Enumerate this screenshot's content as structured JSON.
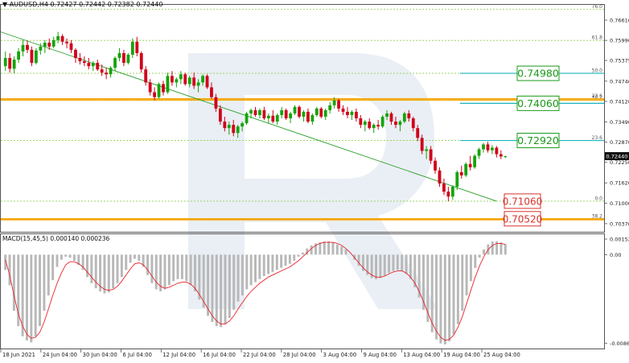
{
  "header": {
    "symbol": "▼ AUDUSD,H4",
    "ohlc": "0.72427 0.72442 0.72382 0.72440"
  },
  "macd_header": "MACD(15,45,5) 0.000140 0.000236",
  "colors": {
    "bull": "#16a30b",
    "bear": "#d0021b",
    "fib_grid": "#8fd14f",
    "fib_orange": "#f5a300",
    "teal_line": "#19b5bd",
    "trendline": "#2ba02b",
    "macd_hist": "#b8b8b8",
    "macd_signal": "#e8232a"
  },
  "chart_data": [
    {
      "type": "candlestick",
      "title": "",
      "x_ticks": [
        "18 Jun 2021",
        "24 Jun 04:00",
        "30 Jun 04:00",
        "6 Jul 04:00",
        "12 Jul 04:00",
        "16 Jul 04:00",
        "22 Jul 04:00",
        "28 Jul 04:00",
        "3 Aug 04:00",
        "9 Aug 04:00",
        "13 Aug 04:00",
        "19 Aug 04:00",
        "25 Aug 04:00"
      ],
      "y_ticks": [
        "0.76610",
        "0.75990",
        "0.75375",
        "0.74740",
        "0.74120",
        "0.73490",
        "0.72870",
        "0.72250",
        "0.71620",
        "0.71000",
        "0.70370"
      ],
      "ylim": [
        0.7012,
        0.7708
      ],
      "current_price": "0.72440",
      "fib_levels": [
        {
          "label": "76.0",
          "value": 0.7694
        },
        {
          "label": "61.8",
          "value": 0.7599
        },
        {
          "label": "50.0",
          "value": 0.7498
        },
        {
          "label": "38.2",
          "value": 0.7415
        },
        {
          "label": "23.6",
          "value": 0.742
        },
        {
          "label": "23.6",
          "value": 0.7292
        },
        {
          "label": "0.0",
          "value": 0.7106
        },
        {
          "label": "38.2",
          "value": 0.7052
        }
      ],
      "orange_lines": [
        0.742,
        0.7416,
        0.7052,
        0.7049
      ],
      "target_boxes": [
        {
          "label": "0.74980",
          "value": 0.7498,
          "style": "green"
        },
        {
          "label": "0.74060",
          "value": 0.7406,
          "style": "green"
        },
        {
          "label": "0.72920",
          "value": 0.7292,
          "style": "green"
        },
        {
          "label": "0.71060",
          "value": 0.7106,
          "style": "red"
        },
        {
          "label": "0.70520",
          "value": 0.7052,
          "style": "red"
        }
      ],
      "trendline": {
        "from": [
          0,
          0.7625
        ],
        "to": [
          112,
          0.7106
        ]
      },
      "candles": [
        [
          0.752,
          0.7565,
          0.7505,
          0.7545
        ],
        [
          0.7545,
          0.756,
          0.75,
          0.7512
        ],
        [
          0.7512,
          0.755,
          0.7498,
          0.754
        ],
        [
          0.754,
          0.7575,
          0.753,
          0.7565
        ],
        [
          0.7565,
          0.76,
          0.755,
          0.7585
        ],
        [
          0.7585,
          0.7598,
          0.756,
          0.757
        ],
        [
          0.757,
          0.758,
          0.752,
          0.753
        ],
        [
          0.753,
          0.7575,
          0.7525,
          0.7568
        ],
        [
          0.7568,
          0.759,
          0.7555,
          0.758
        ],
        [
          0.758,
          0.76,
          0.756,
          0.7592
        ],
        [
          0.7592,
          0.7605,
          0.757,
          0.758
        ],
        [
          0.758,
          0.761,
          0.7575,
          0.76
        ],
        [
          0.76,
          0.7625,
          0.759,
          0.7612
        ],
        [
          0.7612,
          0.7618,
          0.7585,
          0.7595
        ],
        [
          0.7595,
          0.7605,
          0.7575,
          0.759
        ],
        [
          0.759,
          0.76,
          0.756,
          0.757
        ],
        [
          0.757,
          0.7575,
          0.753,
          0.7545
        ],
        [
          0.7545,
          0.756,
          0.7525,
          0.7535
        ],
        [
          0.7535,
          0.755,
          0.752,
          0.753
        ],
        [
          0.753,
          0.7545,
          0.751,
          0.752
        ],
        [
          0.752,
          0.7535,
          0.7505,
          0.753
        ],
        [
          0.753,
          0.754,
          0.7505,
          0.751
        ],
        [
          0.751,
          0.7525,
          0.749,
          0.75
        ],
        [
          0.75,
          0.7515,
          0.748,
          0.7495
        ],
        [
          0.7495,
          0.752,
          0.7485,
          0.7515
        ],
        [
          0.7515,
          0.755,
          0.7505,
          0.7545
        ],
        [
          0.7545,
          0.7575,
          0.7535,
          0.756
        ],
        [
          0.756,
          0.757,
          0.752,
          0.753
        ],
        [
          0.753,
          0.756,
          0.7525,
          0.7555
        ],
        [
          0.7555,
          0.7605,
          0.7545,
          0.7595
        ],
        [
          0.7595,
          0.761,
          0.755,
          0.756
        ],
        [
          0.756,
          0.7565,
          0.75,
          0.751
        ],
        [
          0.751,
          0.752,
          0.746,
          0.747
        ],
        [
          0.747,
          0.748,
          0.743,
          0.744
        ],
        [
          0.744,
          0.7455,
          0.7415,
          0.7425
        ],
        [
          0.7425,
          0.747,
          0.742,
          0.7465
        ],
        [
          0.7465,
          0.7475,
          0.743,
          0.744
        ],
        [
          0.744,
          0.75,
          0.7435,
          0.749
        ],
        [
          0.749,
          0.7505,
          0.746,
          0.747
        ],
        [
          0.747,
          0.7485,
          0.7455,
          0.748
        ],
        [
          0.748,
          0.7505,
          0.7465,
          0.7495
        ],
        [
          0.7495,
          0.75,
          0.746,
          0.7465
        ],
        [
          0.7465,
          0.749,
          0.7455,
          0.7485
        ],
        [
          0.7485,
          0.75,
          0.745,
          0.746
        ],
        [
          0.746,
          0.748,
          0.744,
          0.747
        ],
        [
          0.747,
          0.7495,
          0.746,
          0.749
        ],
        [
          0.749,
          0.7495,
          0.745,
          0.7455
        ],
        [
          0.7455,
          0.747,
          0.742,
          0.7425
        ],
        [
          0.7425,
          0.7435,
          0.738,
          0.739
        ],
        [
          0.739,
          0.74,
          0.734,
          0.735
        ],
        [
          0.735,
          0.7365,
          0.732,
          0.733
        ],
        [
          0.733,
          0.735,
          0.731,
          0.734
        ],
        [
          0.734,
          0.7355,
          0.7305,
          0.7315
        ],
        [
          0.7315,
          0.734,
          0.73,
          0.7335
        ],
        [
          0.7335,
          0.735,
          0.732,
          0.7345
        ],
        [
          0.7345,
          0.738,
          0.734,
          0.7375
        ],
        [
          0.7375,
          0.739,
          0.736,
          0.7385
        ],
        [
          0.7385,
          0.7395,
          0.7365,
          0.737
        ],
        [
          0.737,
          0.739,
          0.736,
          0.7385
        ],
        [
          0.7385,
          0.7395,
          0.7355,
          0.736
        ],
        [
          0.736,
          0.7375,
          0.7345,
          0.7368
        ],
        [
          0.7368,
          0.7385,
          0.7345,
          0.735
        ],
        [
          0.735,
          0.7375,
          0.734,
          0.737
        ],
        [
          0.737,
          0.7395,
          0.736,
          0.7385
        ],
        [
          0.7385,
          0.739,
          0.7355,
          0.736
        ],
        [
          0.736,
          0.738,
          0.7345,
          0.7375
        ],
        [
          0.7375,
          0.74,
          0.737,
          0.7395
        ],
        [
          0.7395,
          0.74,
          0.736,
          0.7365
        ],
        [
          0.7365,
          0.7385,
          0.735,
          0.738
        ],
        [
          0.738,
          0.739,
          0.7345,
          0.735
        ],
        [
          0.735,
          0.7375,
          0.734,
          0.737
        ],
        [
          0.737,
          0.7395,
          0.7365,
          0.739
        ],
        [
          0.739,
          0.7395,
          0.736,
          0.7365
        ],
        [
          0.7365,
          0.739,
          0.7355,
          0.7385
        ],
        [
          0.7385,
          0.741,
          0.7375,
          0.74
        ],
        [
          0.74,
          0.7425,
          0.739,
          0.7415
        ],
        [
          0.7415,
          0.742,
          0.738,
          0.739
        ],
        [
          0.739,
          0.74,
          0.737,
          0.738
        ],
        [
          0.738,
          0.7395,
          0.736,
          0.737
        ],
        [
          0.737,
          0.7385,
          0.7355,
          0.738
        ],
        [
          0.738,
          0.739,
          0.735,
          0.736
        ],
        [
          0.736,
          0.737,
          0.733,
          0.734
        ],
        [
          0.734,
          0.7355,
          0.732,
          0.735
        ],
        [
          0.735,
          0.736,
          0.7325,
          0.733
        ],
        [
          0.733,
          0.7345,
          0.7315,
          0.734
        ],
        [
          0.734,
          0.7355,
          0.7325,
          0.7335
        ],
        [
          0.7335,
          0.737,
          0.733,
          0.7365
        ],
        [
          0.7365,
          0.7385,
          0.7355,
          0.7375
        ],
        [
          0.7375,
          0.738,
          0.734,
          0.735
        ],
        [
          0.735,
          0.7365,
          0.733,
          0.734
        ],
        [
          0.734,
          0.7355,
          0.732,
          0.735
        ],
        [
          0.735,
          0.738,
          0.7345,
          0.7375
        ],
        [
          0.7375,
          0.7385,
          0.735,
          0.736
        ],
        [
          0.736,
          0.7365,
          0.732,
          0.733
        ],
        [
          0.733,
          0.734,
          0.729,
          0.73
        ],
        [
          0.73,
          0.731,
          0.725,
          0.726
        ],
        [
          0.726,
          0.7275,
          0.7235,
          0.7265
        ],
        [
          0.7265,
          0.7275,
          0.722,
          0.723
        ],
        [
          0.723,
          0.724,
          0.719,
          0.72
        ],
        [
          0.72,
          0.721,
          0.715,
          0.716
        ],
        [
          0.716,
          0.7175,
          0.7125,
          0.7135
        ],
        [
          0.7135,
          0.715,
          0.7106,
          0.712
        ],
        [
          0.712,
          0.7155,
          0.711,
          0.715
        ],
        [
          0.715,
          0.72,
          0.714,
          0.7195
        ],
        [
          0.7195,
          0.7215,
          0.7175,
          0.7185
        ],
        [
          0.7185,
          0.7225,
          0.718,
          0.722
        ],
        [
          0.722,
          0.7245,
          0.72,
          0.721
        ],
        [
          0.721,
          0.725,
          0.7205,
          0.7245
        ],
        [
          0.7245,
          0.727,
          0.7235,
          0.7265
        ],
        [
          0.7265,
          0.7285,
          0.7255,
          0.728
        ],
        [
          0.728,
          0.7288,
          0.7255,
          0.7262
        ],
        [
          0.7262,
          0.7278,
          0.725,
          0.727
        ],
        [
          0.727,
          0.7275,
          0.724,
          0.725
        ],
        [
          0.725,
          0.7262,
          0.7235,
          0.7243
        ],
        [
          0.7243,
          0.7245,
          0.7238,
          0.7244
        ]
      ]
    },
    {
      "type": "macd",
      "title": "",
      "y_ticks": [
        "0.001525",
        "0.00",
        "-0.008675"
      ],
      "ylim": [
        -0.0092,
        0.002
      ],
      "histogram": [
        -0.0015,
        -0.003,
        -0.0055,
        -0.007,
        -0.008,
        -0.0084,
        -0.0086,
        -0.008,
        -0.007,
        -0.0055,
        -0.004,
        -0.0025,
        -0.0012,
        -0.0005,
        -0.0002,
        -0.0003,
        -0.0006,
        -0.001,
        -0.0015,
        -0.0022,
        -0.0028,
        -0.0033,
        -0.0036,
        -0.0038,
        -0.0037,
        -0.0033,
        -0.0028,
        -0.0022,
        -0.0015,
        -0.0008,
        -0.0004,
        -0.0006,
        -0.0012,
        -0.002,
        -0.0028,
        -0.0034,
        -0.0036,
        -0.0034,
        -0.003,
        -0.0026,
        -0.0024,
        -0.0024,
        -0.0026,
        -0.003,
        -0.0036,
        -0.0044,
        -0.0052,
        -0.006,
        -0.0066,
        -0.007,
        -0.0071,
        -0.0068,
        -0.0062,
        -0.0054,
        -0.0046,
        -0.004,
        -0.0034,
        -0.003,
        -0.0027,
        -0.0024,
        -0.0021,
        -0.0019,
        -0.0017,
        -0.0015,
        -0.0013,
        -0.0011,
        -0.0009,
        -0.0006,
        -0.0002,
        0.0002,
        0.0006,
        0.0009,
        0.0011,
        0.0012,
        0.0013,
        0.0013,
        0.0012,
        0.001,
        0.0008,
        0.0005,
        0.0,
        -0.0005,
        -0.0011,
        -0.0016,
        -0.002,
        -0.0023,
        -0.0024,
        -0.0023,
        -0.0021,
        -0.0018,
        -0.0016,
        -0.0015,
        -0.0016,
        -0.0019,
        -0.0024,
        -0.0032,
        -0.0042,
        -0.0054,
        -0.0066,
        -0.0076,
        -0.0083,
        -0.0087,
        -0.0088,
        -0.0085,
        -0.0078,
        -0.0068,
        -0.0055,
        -0.004,
        -0.0026,
        -0.0013,
        -0.0003,
        0.0005,
        0.001,
        0.0013,
        0.0013,
        0.0012,
        0.001
      ],
      "signal": [
        -0.0005,
        -0.002,
        -0.004,
        -0.0058,
        -0.007,
        -0.0078,
        -0.0082,
        -0.0081,
        -0.0076,
        -0.0066,
        -0.0053,
        -0.004,
        -0.0028,
        -0.0018,
        -0.001,
        -0.0007,
        -0.0007,
        -0.0009,
        -0.0012,
        -0.0017,
        -0.0022,
        -0.0027,
        -0.0031,
        -0.0034,
        -0.0035,
        -0.0034,
        -0.0031,
        -0.0026,
        -0.002,
        -0.0014,
        -0.0009,
        -0.0008,
        -0.001,
        -0.0015,
        -0.0021,
        -0.0027,
        -0.0031,
        -0.0033,
        -0.0032,
        -0.003,
        -0.0028,
        -0.0027,
        -0.0027,
        -0.0029,
        -0.0033,
        -0.0039,
        -0.0046,
        -0.0053,
        -0.006,
        -0.0065,
        -0.0068,
        -0.0068,
        -0.0065,
        -0.006,
        -0.0053,
        -0.0047,
        -0.0041,
        -0.0036,
        -0.0032,
        -0.0028,
        -0.0025,
        -0.0022,
        -0.002,
        -0.0018,
        -0.0016,
        -0.0014,
        -0.0012,
        -0.0009,
        -0.0006,
        -0.0002,
        0.0002,
        0.0006,
        0.0009,
        0.0011,
        0.0012,
        0.0012,
        0.0012,
        0.0011,
        0.0009,
        0.0006,
        0.0002,
        -0.0003,
        -0.0008,
        -0.0013,
        -0.0017,
        -0.002,
        -0.0022,
        -0.0022,
        -0.0021,
        -0.0019,
        -0.0017,
        -0.0016,
        -0.0016,
        -0.0018,
        -0.0022,
        -0.0028,
        -0.0036,
        -0.0046,
        -0.0057,
        -0.0067,
        -0.0075,
        -0.0081,
        -0.0084,
        -0.0083,
        -0.0079,
        -0.0071,
        -0.0061,
        -0.0048,
        -0.0035,
        -0.0022,
        -0.0011,
        -0.0002,
        0.0005,
        0.0009,
        0.0011,
        0.0011,
        0.001
      ]
    }
  ]
}
